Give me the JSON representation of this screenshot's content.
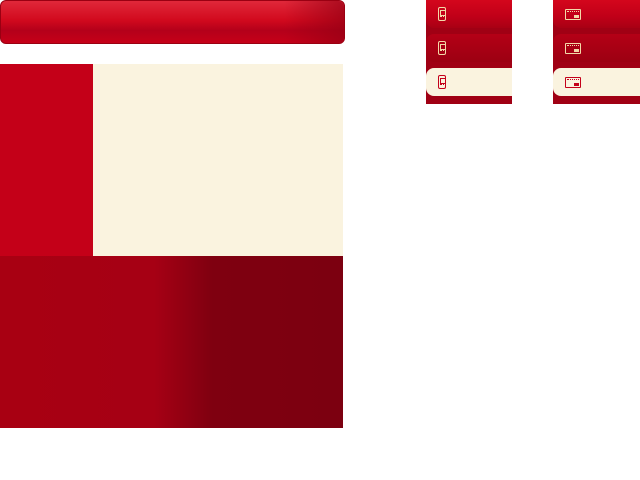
{
  "top_bar": {
    "title": ""
  },
  "panel": {
    "sidebar": "",
    "content": "",
    "footer": ""
  },
  "phone_buttons": [
    {
      "state": "normal",
      "icon": "phone-icon",
      "label": ""
    },
    {
      "state": "hover",
      "icon": "phone-icon",
      "label": ""
    },
    {
      "state": "active",
      "icon": "phone-icon",
      "label": ""
    }
  ],
  "card_buttons": [
    {
      "state": "normal",
      "icon": "card-icon",
      "label": ""
    },
    {
      "state": "hover",
      "icon": "card-icon",
      "label": ""
    },
    {
      "state": "active",
      "icon": "card-icon",
      "label": ""
    }
  ],
  "colors": {
    "brand_red": "#c40018",
    "dark_red": "#7c0010",
    "cream": "#faf3df"
  }
}
